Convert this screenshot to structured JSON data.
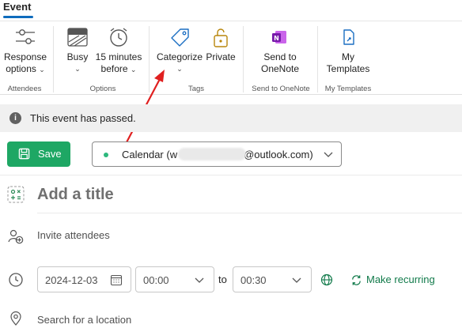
{
  "tabs": {
    "active": "Event"
  },
  "ribbon": {
    "buttons": {
      "response": {
        "line1": "Response",
        "line2": "options"
      },
      "busy": {
        "line1": "Busy"
      },
      "reminder": {
        "line1": "15 minutes",
        "line2": "before"
      },
      "categorize": {
        "line1": "Categorize"
      },
      "private": {
        "line1": "Private"
      },
      "onenote": {
        "line1": "Send to",
        "line2": "OneNote"
      },
      "templates": {
        "line1": "My",
        "line2": "Templates"
      }
    },
    "groups": {
      "attendees": "Attendees",
      "options": "Options",
      "tags": "Tags",
      "onenote": "Send to OneNote",
      "templates": "My Templates"
    }
  },
  "info_bar": {
    "text": "This event has passed."
  },
  "save_label": "Save",
  "calendar": {
    "prefix": "Calendar (w",
    "suffix": "@outlook.com)",
    "dot_color": "#2db87d"
  },
  "form": {
    "title_placeholder": "Add a title",
    "attendees_placeholder": "Invite attendees",
    "start_date": "2024-12-03",
    "start_time": "00:00",
    "to_label": "to",
    "end_time": "00:30",
    "recurring_label": "Make recurring",
    "location_placeholder": "Search for a location"
  },
  "colors": {
    "accent": "#0f6cbd",
    "save_green": "#1ea764",
    "recurring_green": "#117a4a",
    "annotation_arrow": "#e02020"
  },
  "icons": {
    "response": "sliders-icon",
    "busy": "busy-status-icon",
    "reminder": "alarm-clock-icon",
    "categorize": "tag-icon",
    "private": "lock-icon",
    "onenote": "onenote-icon",
    "templates": "template-icon",
    "info": "info-icon",
    "save": "save-icon",
    "title": "title-icon",
    "attendees": "people-add-icon",
    "time": "clock-icon",
    "date_picker": "calendar-icon",
    "timezone": "globe-icon",
    "recurring": "repeat-icon",
    "location": "location-pin-icon"
  }
}
